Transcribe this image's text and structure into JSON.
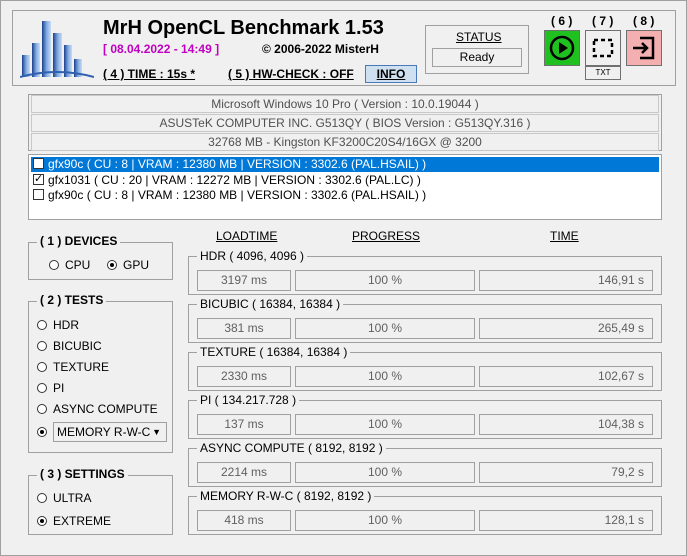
{
  "header": {
    "title": "MrH OpenCL Benchmark 1.53",
    "date": "[ 08.04.2022 - 14:49 ]",
    "copyright": "©  2006-2022 MisterH",
    "time_label": "( 4 ) TIME : 15s *",
    "hwcheck_label": "( 5 ) HW-CHECK : OFF",
    "info_label": "INFO"
  },
  "status": {
    "label": "STATUS",
    "value": "Ready"
  },
  "buttons": {
    "run_num": "( 6 )",
    "crop_num": "( 7 )",
    "exit_num": "( 8 )",
    "txt_label": "TXT",
    "run_icon": "play-icon",
    "crop_icon": "crop-icon",
    "exit_icon": "exit-icon",
    "run_color": "#20c020",
    "exit_color": "#f4b0b0"
  },
  "system": [
    "Microsoft Windows 10 Pro ( Version : 10.0.19044 )",
    "ASUSTeK COMPUTER INC. G513QY ( BIOS Version : G513QY.316 )",
    "32768 MB - Kingston KF3200C20S4/16GX    @ 3200"
  ],
  "devices": [
    {
      "label": "gfx90c ( CU : 8 | VRAM : 12380 MB | VERSION : 3302.6 (PAL.HSAIL) )",
      "checked": false,
      "selected": true
    },
    {
      "label": "gfx1031 ( CU : 20 | VRAM : 12272 MB | VERSION : 3302.6 (PAL.LC) )",
      "checked": true,
      "selected": false
    },
    {
      "label": "gfx90c ( CU : 8 | VRAM : 12380 MB | VERSION : 3302.6 (PAL.HSAIL) )",
      "checked": false,
      "selected": false
    }
  ],
  "devices_group": {
    "title": "( 1 ) DEVICES",
    "cpu": "CPU",
    "gpu": "GPU"
  },
  "tests_group": {
    "title": "( 2 ) TESTS",
    "items": [
      "HDR",
      "BICUBIC",
      "TEXTURE",
      "PI",
      "ASYNC COMPUTE"
    ],
    "memory_select": "MEMORY R-W-C"
  },
  "settings_group": {
    "title": "( 3 ) SETTINGS",
    "ultra": "ULTRA",
    "extreme": "EXTREME"
  },
  "columns": {
    "loadtime": "LOADTIME",
    "progress": "PROGRESS",
    "time": "TIME"
  },
  "results": [
    {
      "title": "HDR ( 4096, 4096 )",
      "loadtime": "3197 ms",
      "progress": "100 %",
      "time": "146,91 s"
    },
    {
      "title": "BICUBIC ( 16384, 16384 )",
      "loadtime": "381 ms",
      "progress": "100 %",
      "time": "265,49 s"
    },
    {
      "title": "TEXTURE ( 16384, 16384 )",
      "loadtime": "2330 ms",
      "progress": "100 %",
      "time": "102,67 s"
    },
    {
      "title": "PI ( 134.217.728 )",
      "loadtime": "137 ms",
      "progress": "100 %",
      "time": "104,38 s"
    },
    {
      "title": "ASYNC COMPUTE ( 8192, 8192 )",
      "loadtime": "2214 ms",
      "progress": "100 %",
      "time": "79,2 s"
    },
    {
      "title": "MEMORY R-W-C ( 8192, 8192 )",
      "loadtime": "418 ms",
      "progress": "100 %",
      "time": "128,1 s"
    }
  ]
}
